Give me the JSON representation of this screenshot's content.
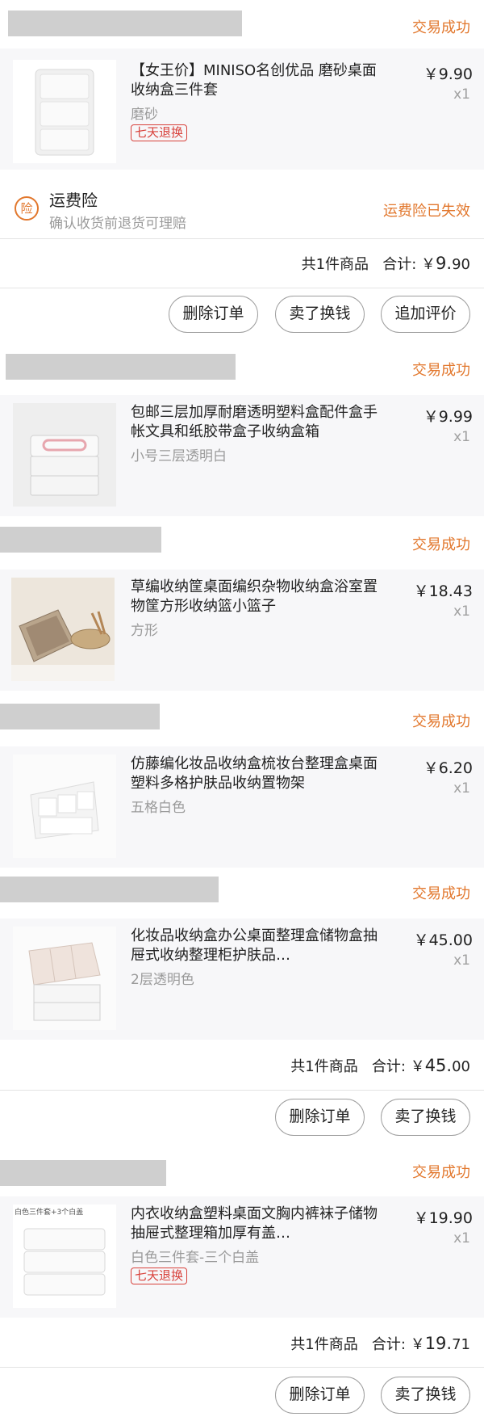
{
  "orders": [
    {
      "status": "交易成功",
      "item": {
        "title": "【女王价】MINISO名创优品 磨砂桌面收纳盒三件套",
        "spec": "磨砂",
        "tag": "七天退换",
        "price": "￥9.90",
        "qty": "x1"
      },
      "insurance": {
        "icon": "险",
        "title": "运费险",
        "subtitle": "确认收货前退货可理赔",
        "status": "运费险已失效"
      },
      "summary": {
        "count_text": "共1件商品",
        "total_label": "合计:",
        "currency": "￥",
        "amount_main": "9.",
        "amount_cents": "90"
      },
      "buttons": [
        "删除订单",
        "卖了换钱",
        "追加评价"
      ]
    },
    {
      "status": "交易成功",
      "item": {
        "title": "包邮三层加厚耐磨透明塑料盒配件盒手帐文具和纸胶带盒子收纳盒箱",
        "spec": "小号三层透明白",
        "price": "￥9.99",
        "qty": "x1"
      }
    },
    {
      "status": "交易成功",
      "item": {
        "title": "草编收纳筐桌面编织杂物收纳盒浴室置物筐方形收纳篮小篮子",
        "spec": "方形",
        "price": "￥18.43",
        "qty": "x1"
      }
    },
    {
      "status": "交易成功",
      "item": {
        "title": "仿藤编化妆品收纳盒梳妆台整理盒桌面塑料多格护肤品收纳置物架",
        "spec": "五格白色",
        "price": "￥6.20",
        "qty": "x1"
      }
    },
    {
      "status": "交易成功",
      "item": {
        "title": "化妆品收纳盒办公桌面整理盒储物盒抽屉式收纳整理柜护肤品…",
        "spec": "2层透明色",
        "price": "￥45.00",
        "qty": "x1"
      },
      "summary": {
        "count_text": "共1件商品",
        "total_label": "合计:",
        "currency": "￥",
        "amount_main": "45.",
        "amount_cents": "00"
      },
      "buttons": [
        "删除订单",
        "卖了换钱"
      ]
    },
    {
      "status": "交易成功",
      "item": {
        "title": "内衣收纳盒塑料桌面文胸内裤袜子储物抽屉式整理箱加厚有盖…",
        "spec": "白色三件套-三个白盖",
        "tag": "七天退换",
        "thumb_caption": "白色三件套+3个白盖",
        "price": "￥19.90",
        "qty": "x1"
      },
      "summary": {
        "count_text": "共1件商品",
        "total_label": "合计:",
        "currency": "￥",
        "amount_main": "19.",
        "amount_cents": "71"
      },
      "buttons": [
        "删除订单",
        "卖了换钱"
      ]
    }
  ],
  "colors": {
    "status_orange": "#e2782e",
    "tag_red": "#d8413b",
    "redaction_gray": "#cfcfcf",
    "item_bg": "#f7f7f9"
  }
}
